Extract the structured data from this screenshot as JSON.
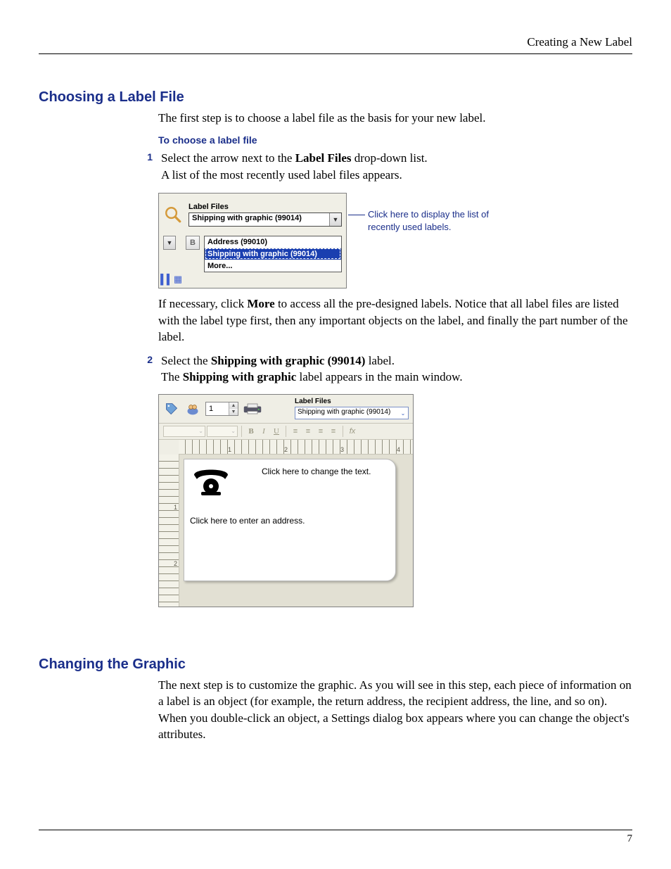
{
  "header": {
    "chapter": "Creating a New Label"
  },
  "footer": {
    "page": "7"
  },
  "sections": {
    "s1": {
      "title": "Choosing a Label File",
      "intro": "The first step is to choose a label file as the basis for your new label.",
      "procTitle": "To choose a label file",
      "step1": {
        "num": "1",
        "pre": "Select the arrow next to the ",
        "bold": "Label Files",
        "post": " drop-down list.",
        "line2": "A list of the most recently used label files appears."
      },
      "afterFig1_a": "If necessary, click ",
      "afterFig1_bold": "More",
      "afterFig1_b": " to access all the pre-designed labels. Notice that all label files are listed with the label type first, then any important objects on the label, and finally the part number of the label.",
      "step2": {
        "num": "2",
        "pre": "Select the ",
        "bold": "Shipping with graphic (99014)",
        "post": " label.",
        "line2a": "The ",
        "line2bold": "Shipping with graphic",
        "line2b": " label appears in the main window."
      }
    },
    "s2": {
      "title": "Changing the Graphic",
      "para": "The next step is to customize the graphic. As you will see in this step, each piece of information on a label is an object (for example, the return address, the recipient address, the line, and so on). When you double-click an object, a Settings dialog box appears where you can change the object's attributes."
    }
  },
  "fig1": {
    "caption": "Label Files",
    "selected": "Shipping with graphic (99014)",
    "items": {
      "a": "Address (99010)",
      "b": "Shipping with graphic (99014)",
      "c": "More..."
    },
    "callout": "Click here to display the list of recently used labels."
  },
  "fig2": {
    "spinner": "1",
    "caption": "Label Files",
    "selected": "Shipping with graphic (99014)",
    "fmt": {
      "b": "B",
      "i": "I",
      "u": "U",
      "al": "≡",
      "ac": "≡",
      "ar": "≡",
      "aj": "≡",
      "fx": "fx"
    },
    "rulerH": {
      "n1": "1",
      "n2": "2",
      "n3": "3",
      "n4": "4"
    },
    "rulerV": {
      "n1": "1",
      "n2": "2"
    },
    "changeText": "Click here to change the text.",
    "enterAddress": "Click here to enter an address."
  }
}
